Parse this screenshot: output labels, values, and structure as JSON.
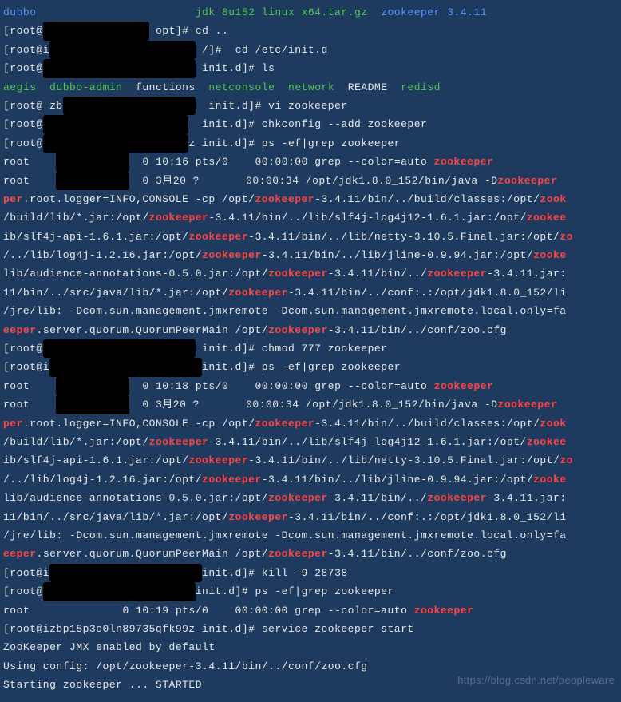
{
  "top": {
    "dubbo": "dubbo",
    "mid": "jdk 8u152 linux x64.tar.gz",
    "zk": "zookeeper 3.4.11"
  },
  "p1": {
    "prefix": "[root@",
    "dir": "opt]# ",
    "cmd": "cd .."
  },
  "p2": {
    "prefix": "[root@i",
    "dir": "/]#  ",
    "cmd": "cd /etc/init.d"
  },
  "p3": {
    "prefix": "[root@",
    "dir": "init.d]# ",
    "cmd": "ls"
  },
  "ls": {
    "aegis": "aegis",
    "dubbo": "dubbo-admin",
    "functions": "functions",
    "netconsole": "netconsole",
    "network": "network",
    "readme": "README",
    "redisd": "redisd"
  },
  "p4": {
    "prefix": "[root@ zb",
    "dir": "init.d]# ",
    "cmd": "vi zookeeper"
  },
  "p5": {
    "prefix": "[root@",
    "dir": "init.d]# ",
    "cmd": "chkconfig --add zookeeper"
  },
  "p6": {
    "prefix": "[root@",
    "dir": "z init.d]# ",
    "cmd": "ps -ef|grep zookeeper"
  },
  "ps1a": {
    "user": "root",
    "c1": "0 10:16 pts/0    00:00:00 grep --color=auto ",
    "zk": "zookeeper"
  },
  "ps1b": {
    "user": "root",
    "c1": "0 3月20 ?       00:00:34 /opt/jdk1.8.0_152/bin/java -D",
    "zk": "zookeeper"
  },
  "path": {
    "l1a": "per",
    "l1b": ".root.logger=INFO,CONSOLE -cp /opt/",
    "l1c": "zookeeper",
    "l1d": "-3.4.11/bin/../build/classes:/opt/",
    "l1e": "zook",
    "l2a": "/build/lib/*.jar:/opt/",
    "l2b": "zookeeper",
    "l2c": "-3.4.11/bin/../lib/slf4j-log4j12-1.6.1.jar:/opt/",
    "l2d": "zookee",
    "l3a": "ib/slf4j-api-1.6.1.jar:/opt/",
    "l3b": "zookeeper",
    "l3c": "-3.4.11/bin/../lib/netty-3.10.5.Final.jar:/opt/",
    "l3d": "zo",
    "l4a": "/../lib/log4j-1.2.16.jar:/opt/",
    "l4b": "zookeeper",
    "l4c": "-3.4.11/bin/../lib/jline-0.9.94.jar:/opt/",
    "l4d": "zooke",
    "l5a": "lib/audience-annotations-0.5.0.jar:/opt/",
    "l5b": "zookeeper",
    "l5c": "-3.4.11/bin/../",
    "l5d": "zookeeper",
    "l5e": "-3.4.11.jar:",
    "l6a": "11/bin/../src/java/lib/*.jar:/opt/",
    "l6b": "zookeeper",
    "l6c": "-3.4.11/bin/../conf:.:/opt/jdk1.8.0_152/li",
    "l7": "/jre/lib: -Dcom.sun.management.jmxremote -Dcom.sun.management.jmxremote.local.only=fa",
    "l8a": "eeper",
    "l8b": ".server.quorum.QuorumPeerMain /opt/",
    "l8c": "zookeeper",
    "l8d": "-3.4.11/bin/../conf/zoo.cfg"
  },
  "p7": {
    "prefix": "[root@",
    "dir": " init.d]# ",
    "cmd": "chmod 777 zookeeper"
  },
  "p8": {
    "prefix": "[root@i",
    "dir": "init.d]# ",
    "cmd": "ps -ef|grep zookeeper"
  },
  "ps2a": {
    "user": "root",
    "c1": "0 10:18 pts/0    00:00:00 grep --color=auto ",
    "zk": "zookeeper"
  },
  "ps2b": {
    "user": "root",
    "c1": "0 3月20 ?       00:00:34 /opt/jdk1.8.0_152/bin/java -D",
    "zk": "zookeeper"
  },
  "p9": {
    "prefix": "[root@i",
    "dir": "init.d]# ",
    "cmd": "kill -9 28738"
  },
  "p10": {
    "prefix": "[root@",
    "dir": "init.d]# ",
    "cmd": "ps -ef|grep zookeeper"
  },
  "ps3a": {
    "user": "root",
    "c1": "0 10:19 pts/0    00:00:00 grep --color=auto ",
    "zk": "zookeeper"
  },
  "p11": {
    "prefix": "[root@izbp15p3o0ln89735qfk99z init.d]# ",
    "cmd": "service zookeeper start"
  },
  "out1": "ZooKeeper JMX enabled by default",
  "out2": "Using config: /opt/zookeeper-3.4.11/bin/../conf/zoo.cfg",
  "out3": "Starting zookeeper ... STARTED",
  "watermark": "https://blog.csdn.net/peopleware"
}
